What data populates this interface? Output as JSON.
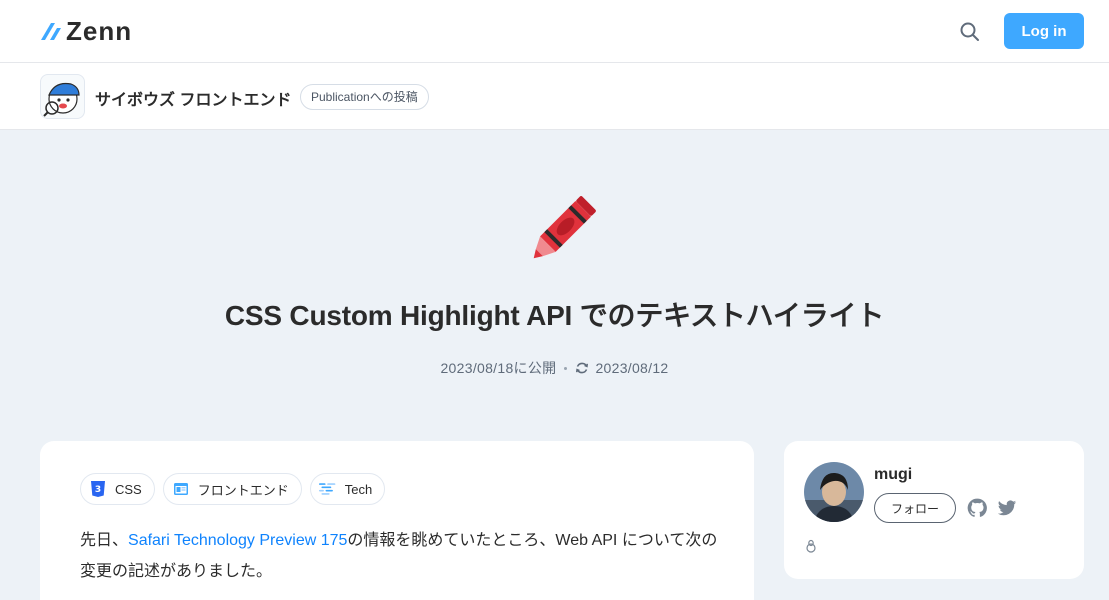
{
  "header": {
    "logo_text": "Zenn",
    "login_label": "Log in"
  },
  "publication": {
    "name": "サイボウズ フロントエンド",
    "badge": "Publicationへの投稿"
  },
  "article": {
    "emoji": "crayon",
    "title": "CSS Custom Highlight API でのテキストハイライト",
    "published": "2023/08/18に公開",
    "updated": "2023/08/12",
    "tags": [
      {
        "label": "CSS",
        "icon": "css3-icon"
      },
      {
        "label": "フロントエンド",
        "icon": "frontend-icon"
      },
      {
        "label": "Tech",
        "icon": "tech-icon"
      }
    ],
    "body_prefix": "先日、",
    "body_link": "Safari Technology Preview 175",
    "body_suffix": "の情報を眺めていたところ、Web API について次の変更の記述がありました。"
  },
  "author": {
    "name": "mugi",
    "follow_label": "フォロー"
  },
  "colors": {
    "accent": "#3ea8ff",
    "link": "#0f83fd",
    "background": "#edf2f7"
  }
}
